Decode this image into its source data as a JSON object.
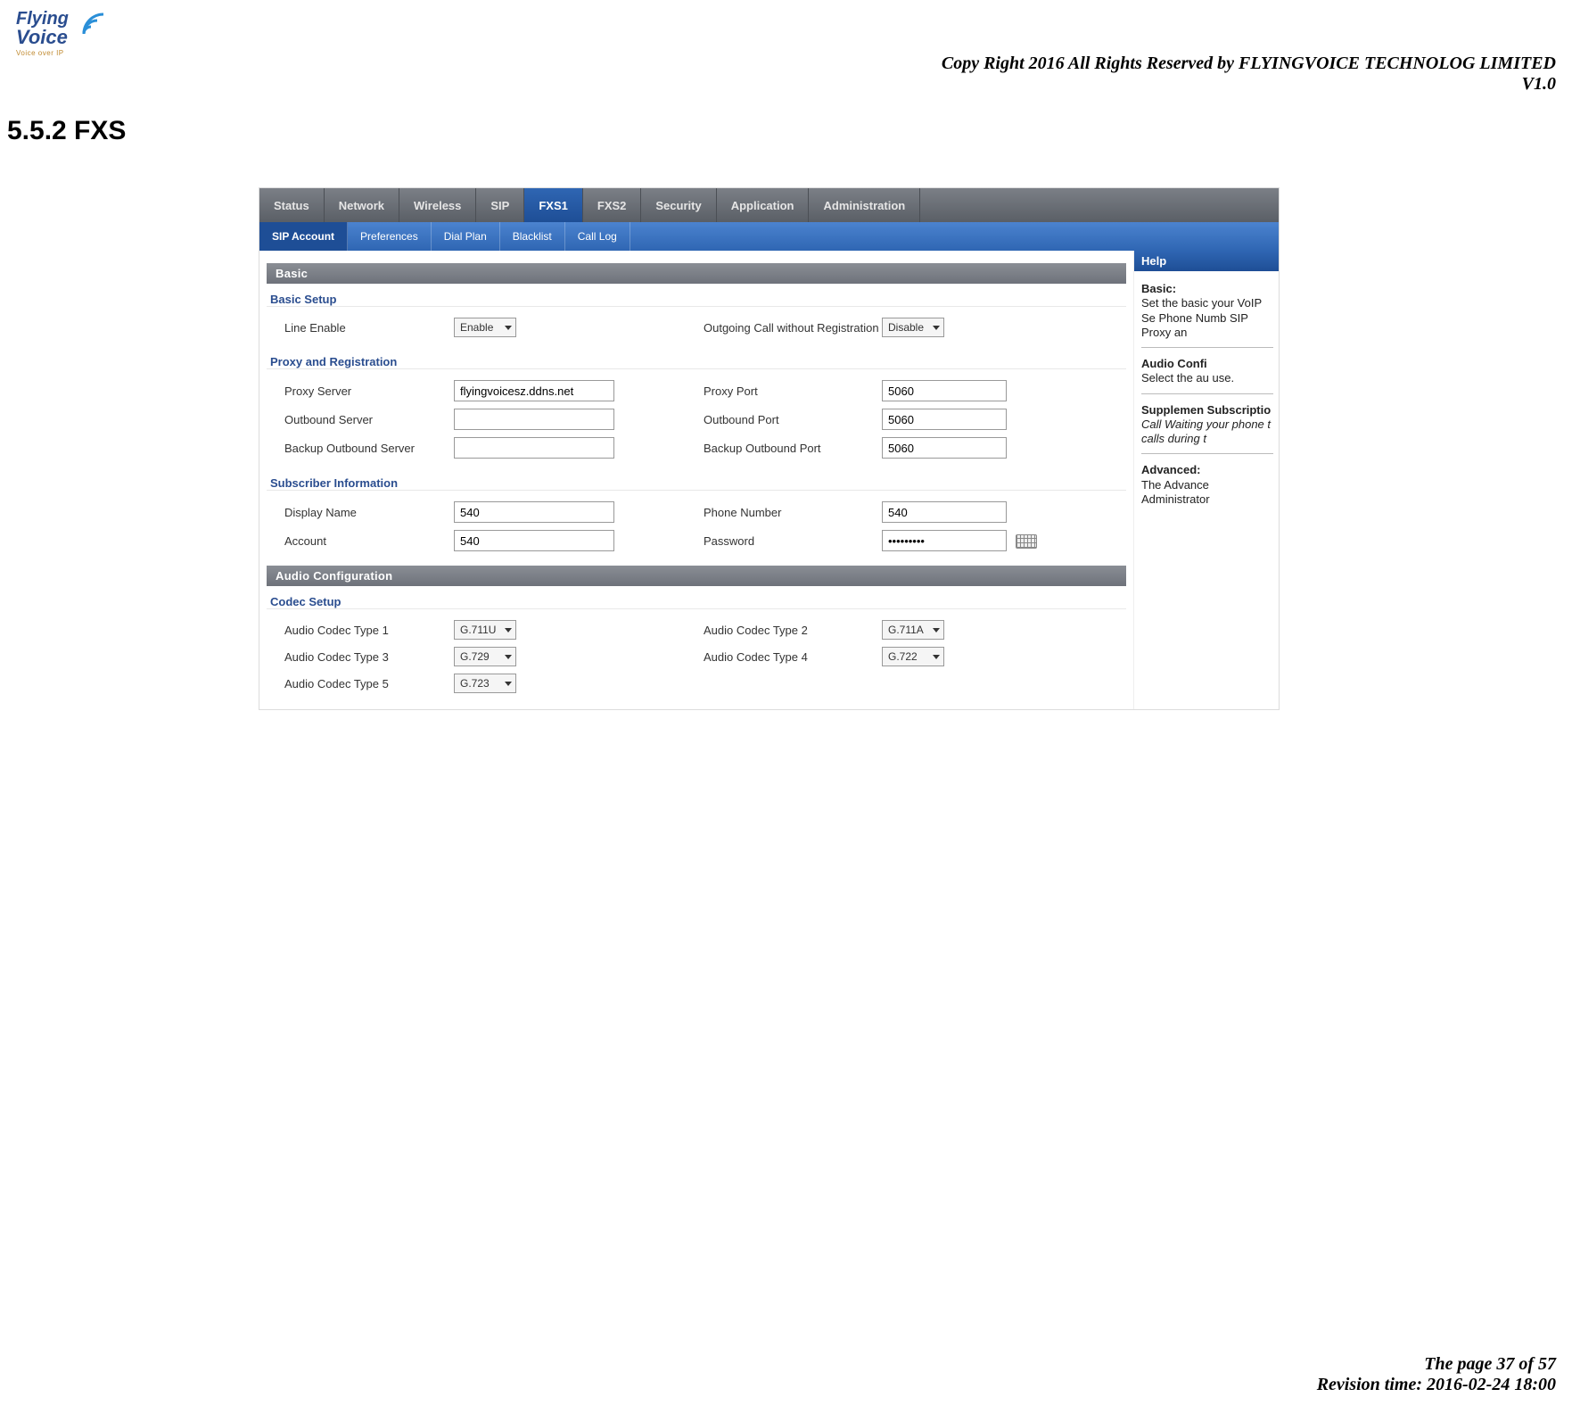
{
  "header": {
    "logo_top": "Flying",
    "logo_bottom": "Voice",
    "logo_sub": "Voice over IP",
    "copyright": "Copy Right 2016 All Rights Reserved by FLYINGVOICE TECHNOLOG LIMITED",
    "version": "V1.0"
  },
  "section_heading": "5.5.2 FXS",
  "topnav": {
    "items": [
      "Status",
      "Network",
      "Wireless",
      "SIP",
      "FXS1",
      "FXS2",
      "Security",
      "Application",
      "Administration"
    ],
    "active_index": 4
  },
  "subnav": {
    "items": [
      "SIP Account",
      "Preferences",
      "Dial Plan",
      "Blacklist",
      "Call Log"
    ],
    "active_index": 0
  },
  "panels": {
    "basic_header": "Basic",
    "audio_header": "Audio Configuration"
  },
  "groups": {
    "basic_setup": "Basic Setup",
    "proxy_reg": "Proxy and Registration",
    "subscriber": "Subscriber Information",
    "codec_setup": "Codec Setup"
  },
  "labels": {
    "line_enable": "Line Enable",
    "outgoing_no_reg": "Outgoing Call without Registration",
    "proxy_server": "Proxy Server",
    "proxy_port": "Proxy Port",
    "outbound_server": "Outbound Server",
    "outbound_port": "Outbound Port",
    "backup_outbound_server": "Backup Outbound Server",
    "backup_outbound_port": "Backup Outbound Port",
    "display_name": "Display Name",
    "phone_number": "Phone Number",
    "account": "Account",
    "password": "Password",
    "codec1": "Audio Codec Type 1",
    "codec2": "Audio Codec Type 2",
    "codec3": "Audio Codec Type 3",
    "codec4": "Audio Codec Type 4",
    "codec5": "Audio Codec Type 5"
  },
  "values": {
    "line_enable": "Enable",
    "outgoing_no_reg": "Disable",
    "proxy_server": "flyingvoicesz.ddns.net",
    "proxy_port": "5060",
    "outbound_server": "",
    "outbound_port": "5060",
    "backup_outbound_server": "",
    "backup_outbound_port": "5060",
    "display_name": "540",
    "phone_number": "540",
    "account": "540",
    "password": "•••••••••",
    "codec1": "G.711U",
    "codec2": "G.711A",
    "codec3": "G.729",
    "codec4": "G.722",
    "codec5": "G.723"
  },
  "help": {
    "title": "Help",
    "basic_head": "Basic:",
    "basic_body": "Set the basic your VoIP Se Phone Numb SIP Proxy an",
    "audio_head": "Audio Confi",
    "audio_body": "Select the au use.",
    "supp_head": "Supplemen Subscriptio",
    "supp_body": "Call Waiting your phone t calls during t",
    "adv_head": "Advanced:",
    "adv_body": "The Advance Administrator"
  },
  "footer": {
    "page": "The page 37 of 57",
    "revision": "Revision time: 2016-02-24 18:00"
  }
}
